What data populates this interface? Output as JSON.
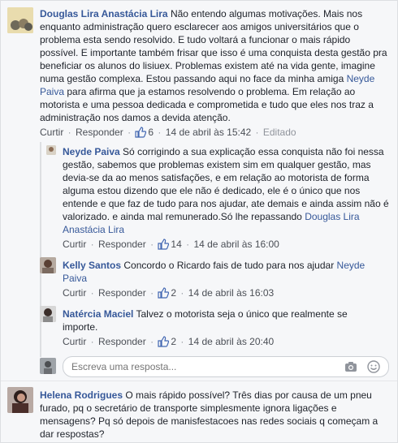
{
  "comments": [
    {
      "author": "Douglas Lira Anastácia Lira",
      "text_1": " Não entendo algumas motivações. Mais nos enquanto administração quero esclarecer aos amigos universitários que o problema esta sendo resolvido. E tudo voltará a funcionar o mais rápido possível. E importante também frisar que isso é uma conquista desta gestão pra beneficiar os alunos do lisiuex. Problemas existem até na vida gente, imagine numa gestão complexa. Estou passando aqui no face da minha amiga ",
      "mention": "Neyde Paiva",
      "text_2": " para afirma que ja estamos resolvendo o problema. Em relação ao motorista e uma pessoa dedicada e comprometida e tudo que eles nos traz a administração nos damos a devida atenção.",
      "reply_label": "Curtir",
      "respond_label": "Responder",
      "likes": "6",
      "timestamp": "14 de abril às 15:42",
      "edited": "Editado"
    },
    {
      "author": "Neyde Paiva",
      "text_1": " Só corrigindo a sua explicação essa conquista não foi nessa gestão, sabemos que problemas existem sim em qualquer gestão, mas devia-se da ao menos satisfações, e em relação ao motorista de forma alguma estou dizendo que ele não é dedicado, ele é o único que nos entende e que faz de tudo para nos ajudar, ate demais e ainda assim não é valorizado. e ainda mal remunerado.Só lhe repassando ",
      "mention": "Douglas Lira Anastácia Lira",
      "text_2": "",
      "reply_label": "Curtir",
      "respond_label": "Responder",
      "likes": "14",
      "timestamp": "14 de abril às 16:00"
    },
    {
      "author": "Kelly Santos",
      "text_1": " Concordo o Ricardo fais de tudo para nos ajudar ",
      "mention": "Neyde Paiva",
      "text_2": "",
      "reply_label": "Curtir",
      "respond_label": "Responder",
      "likes": "2",
      "timestamp": "14 de abril às 16:03"
    },
    {
      "author": "Natércia Maciel",
      "text_1": " Talvez o motorista seja o único que realmente se importe.",
      "reply_label": "Curtir",
      "respond_label": "Responder",
      "likes": "2",
      "timestamp": "14 de abril às 20:40"
    },
    {
      "author": "Helena Rodrigues",
      "text_1": " O mais rápido possível? Três dias por causa de um pneu furado, pq o secretário de transporte simplesmente ignora ligações e mensagens? Pq só depois de manisfestacoes nas redes sociais q começam a dar respostas?"
    }
  ],
  "reply_box": {
    "placeholder": "Escreva uma resposta..."
  },
  "icons": {
    "like": "thumbs-up-icon",
    "camera": "camera-icon",
    "emoji": "smiley-icon"
  },
  "colors": {
    "link": "#365899",
    "meta": "#90949c",
    "like": "#4267b2"
  }
}
